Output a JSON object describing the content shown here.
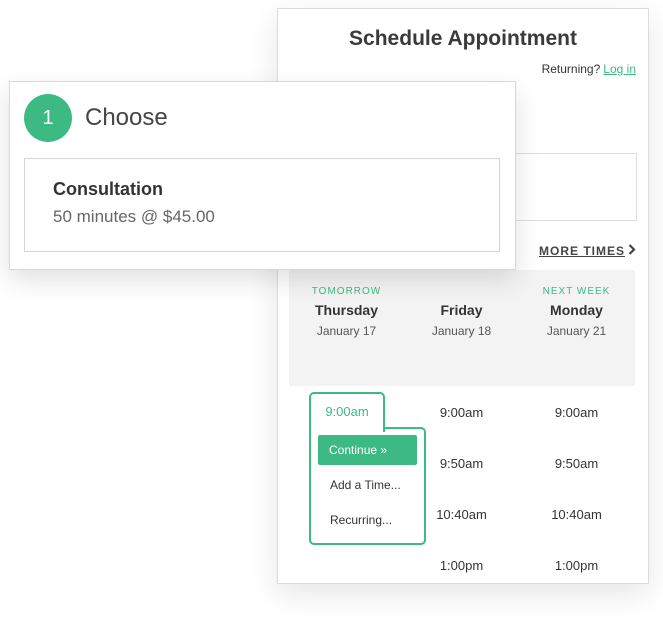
{
  "panel": {
    "title": "Schedule Appointment",
    "returning_text": "Returning?",
    "login_label": "Log in",
    "more_times_label": "MORE TIMES",
    "more_times_icon": "chevron-right-icon"
  },
  "days": [
    {
      "tag": "TOMORROW",
      "name": "Thursday",
      "date": "January 17"
    },
    {
      "tag": "",
      "name": "Friday",
      "date": "January 18"
    },
    {
      "tag": "NEXT WEEK",
      "name": "Monday",
      "date": "January 21"
    }
  ],
  "slots": {
    "thursday": [
      "9:00am"
    ],
    "friday": [
      "9:00am",
      "9:50am",
      "10:40am",
      "1:00pm"
    ],
    "monday": [
      "9:00am",
      "9:50am",
      "10:40am",
      "1:00pm"
    ]
  },
  "selected_menu": {
    "continue_label": "Continue »",
    "add_time_label": "Add a Time...",
    "recurring_label": "Recurring..."
  },
  "choose": {
    "step_number": "1",
    "step_label": "Choose",
    "service_name": "Consultation",
    "service_detail": "50 minutes @ $45.00"
  },
  "colors": {
    "accent": "#3dba84",
    "band": "#f3f3f3"
  }
}
